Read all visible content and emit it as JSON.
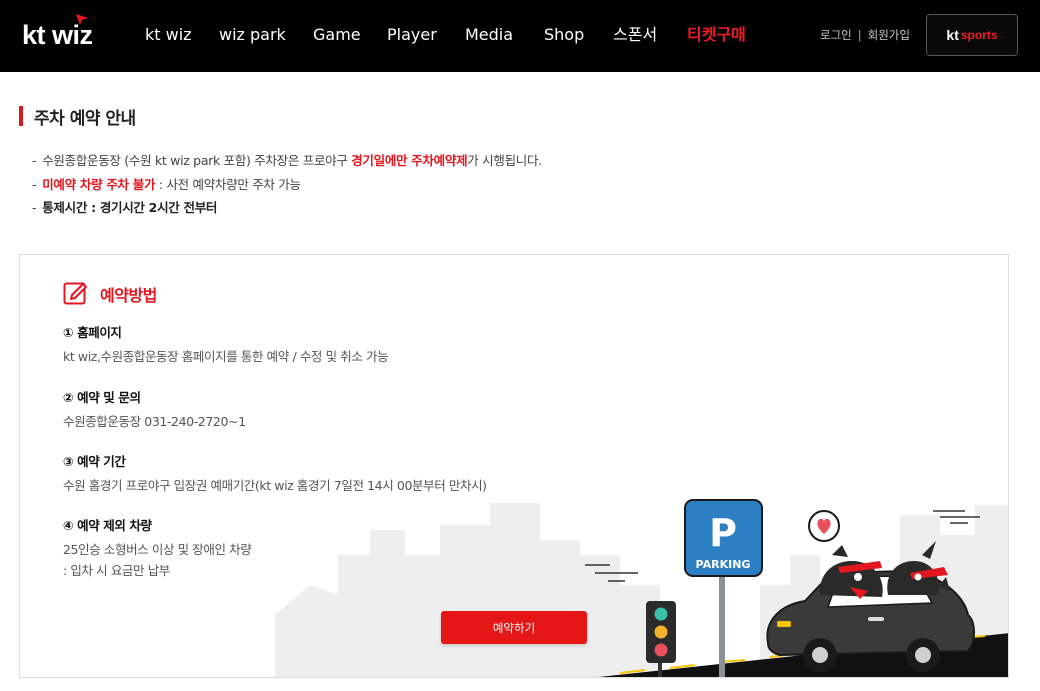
{
  "header": {
    "logo_text": "kt wiz",
    "nav": [
      "kt wiz",
      "wiz park",
      "Game",
      "Player",
      "Media",
      "Shop",
      "스폰서",
      "티켓구매"
    ],
    "login": "로그인",
    "separator": "|",
    "signup": "회원가입",
    "ktsports_kt": "kt",
    "ktsports_sports": "sports"
  },
  "section": {
    "title": "주차 예약 안내",
    "line1_pre": "수원종합운동장 (수원 kt wiz park 포함) 주차장은 프로야구 ",
    "line1_highlight": "경기일에만 주차예약제",
    "line1_post": "가 시행됩니다.",
    "line2_highlight": "미예약 차량 주차 불가",
    "line2_post": " : 사전 예약차량만 주차 가능",
    "line3": "통제시간 : 경기시간 2시간 전부터",
    "dash": "-"
  },
  "method": {
    "title": "예약방법",
    "steps": [
      {
        "title": "① 홈페이지",
        "lines": [
          "kt wiz,수원종합운동장 홈페이지를 통한 예약 / 수정 및 취소 가능"
        ]
      },
      {
        "title": "② 예약 및 문의",
        "lines": [
          "수원종합운동장 031-240-2720~1"
        ]
      },
      {
        "title": "③ 예약 기간",
        "lines": [
          "수원 홈경기 프로야구 입장권 예매기간(kt wiz 홈경기 7일전 14시 00분부터 만차시)"
        ]
      },
      {
        "title": "④ 예약 제외 차량",
        "lines": [
          "25인승 소형버스 이상 및 장애인 차량",
          ": 입차 시 요금만 납부"
        ]
      }
    ],
    "button": "예약하기",
    "parking_sign_letter": "P",
    "parking_sign_label": "PARKING"
  },
  "colors": {
    "accent": "#e2171f",
    "header_bg": "#000000",
    "sign_blue": "#2c7fc2"
  }
}
